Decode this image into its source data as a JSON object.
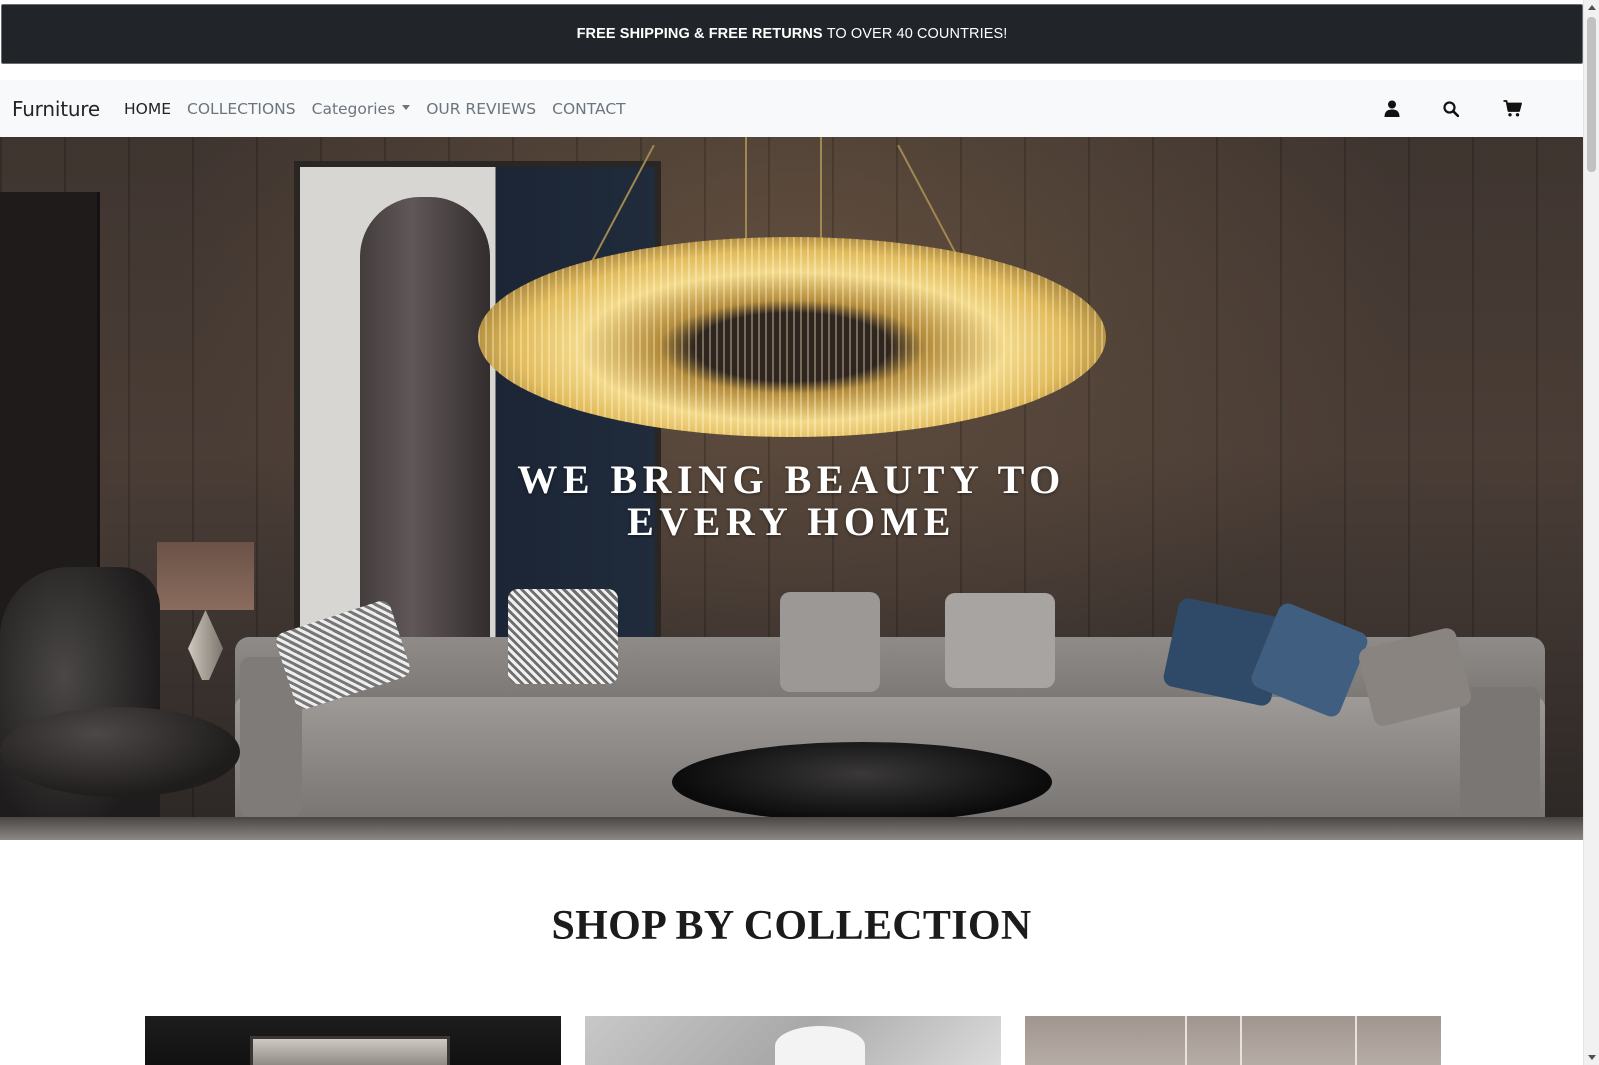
{
  "announcement": {
    "bold_text": "FREE SHIPPING & FREE RETURNS",
    "normal_text": "TO OVER 40 COUNTRIES!"
  },
  "navbar": {
    "brand": "Furniture",
    "links": [
      {
        "label": "HOME",
        "active": true
      },
      {
        "label": "COLLECTIONS",
        "active": false
      },
      {
        "label": "Categories",
        "active": false,
        "dropdown": true
      },
      {
        "label": "OUR REVIEWS",
        "active": false
      },
      {
        "label": "CONTACT",
        "active": false
      }
    ],
    "icons": [
      "user-icon",
      "search-icon",
      "cart-icon"
    ]
  },
  "hero": {
    "headline_line1": "WE BRING BEAUTY TO",
    "headline_line2": "EVERY HOME"
  },
  "collections": {
    "title": "SHOP BY COLLECTION"
  },
  "colors": {
    "announcement_bg": "#212529",
    "navbar_bg": "#f8f9fa",
    "nav_active": "#212529",
    "nav_inactive": "#6c757d"
  }
}
